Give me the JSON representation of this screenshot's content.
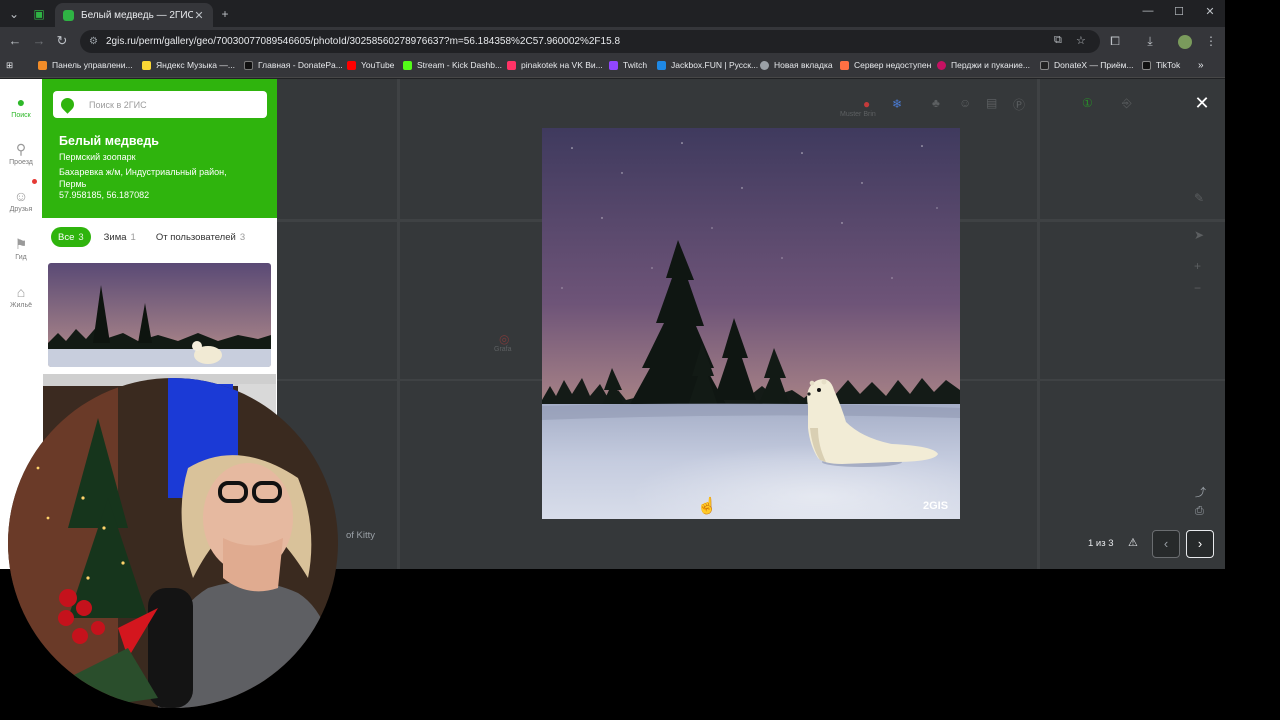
{
  "browser": {
    "tab": {
      "title": "Белый медведь — 2ГИС",
      "close": "✕"
    },
    "new_tab": "+",
    "window_controls": {
      "minimize": "—",
      "maximize": "☐",
      "close": "✕"
    },
    "url": "2gis.ru/perm/gallery/geo/70030077089546605/photoId/30258560278976637?m=56.184358%2C57.960002%2F15.8",
    "bookmarks": [
      {
        "label": "Панель управлени...",
        "color": "#f28c28"
      },
      {
        "label": "Яндекс Музыка —...",
        "color": "#fdd835"
      },
      {
        "label": "Главная - DonatePa...",
        "color": "#111111"
      },
      {
        "label": "YouTube",
        "color": "#ff0000"
      },
      {
        "label": "Stream - Kick Dashb...",
        "color": "#53fc18"
      },
      {
        "label": "pinakotek на VK Ви...",
        "color": "#ff3366"
      },
      {
        "label": "Twitch",
        "color": "#9146ff"
      },
      {
        "label": "Jackbox.FUN | Русск...",
        "color": "#1e88e5"
      },
      {
        "label": "Новая вкладка",
        "color": "#9aa0a6"
      },
      {
        "label": "Сервер недоступен",
        "color": "#ff7043"
      },
      {
        "label": "Перджи и пукание...",
        "color": "#c51162"
      },
      {
        "label": "DonateX — Приём...",
        "color": "#222222"
      },
      {
        "label": "TikTok",
        "color": "#111111"
      }
    ]
  },
  "sidebar_rail": [
    {
      "label": "Поиск",
      "icon": "pin-icon",
      "glyph": "●",
      "active": true
    },
    {
      "label": "Проезд",
      "icon": "route-icon",
      "glyph": "⚲",
      "active": false
    },
    {
      "label": "Друзья",
      "icon": "friends-icon",
      "glyph": "👥",
      "active": false
    },
    {
      "label": "Гид",
      "icon": "flag-icon",
      "glyph": "⚑",
      "active": false
    },
    {
      "label": "Жильё",
      "icon": "house-icon",
      "glyph": "⌂",
      "active": false
    }
  ],
  "panel": {
    "search_placeholder": "Поиск в 2ГИС",
    "title": "Белый медведь",
    "subtitle": "Пермский зоопарк",
    "address": "Бахаревка ж/м, Индустриальный район, Пермь",
    "coords": "57.958185, 56.187082",
    "filters": [
      {
        "label": "Все",
        "count": "3",
        "active": true
      },
      {
        "label": "Зима",
        "count": "1",
        "active": false
      },
      {
        "label": "От пользователей",
        "count": "3",
        "active": false
      }
    ]
  },
  "viewer": {
    "counter": "1 из 3",
    "author": "of Kitty",
    "watermark": "2GIS",
    "prev": "‹",
    "next": "›",
    "close": "✕",
    "map_labels": [
      "Grafa",
      "Muster Brin"
    ]
  }
}
